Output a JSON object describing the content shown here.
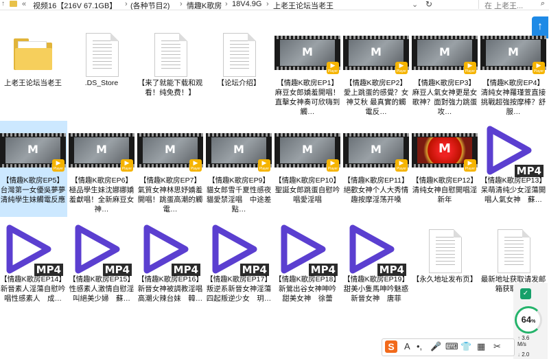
{
  "address_bar": {
    "crumbs": [
      "视频16【216V 67.1GB】",
      "(各种节目2)",
      "情趣K歌房",
      "18V4.9G",
      "上老王论坛当老王"
    ],
    "search_placeholder": "在 上老王..."
  },
  "files": [
    {
      "type": "folder",
      "name": "上老王论坛当老王"
    },
    {
      "type": "doc",
      "name": ".DS_Store"
    },
    {
      "type": "doc",
      "name": "【来了就能下载和观看！纯免费！】"
    },
    {
      "type": "doc",
      "name": "【论坛介绍】"
    },
    {
      "type": "video",
      "name": "【情趣K歌房EP1】麻豆女郎嬌羞開唱！直擊女神奏可欣嗨到觸…"
    },
    {
      "type": "video",
      "name": "【情趣K歌房EP2】愛上跳蛋的感覺？女神艾秋 最真實的觸電反…"
    },
    {
      "type": "video",
      "name": "【情趣K歌房EP3】麻豆人氣女神更是女歌神？面對強力跳蛋攻…"
    },
    {
      "type": "video",
      "name": "【情趣K歌房EP4】清純女神羅瑾萱直接挑戰超強按摩棒？舒服…"
    },
    {
      "type": "video",
      "name": "【情趣K歌房EP5】台灣第一女優吳夢夢　清純學生妹觸電反應",
      "selected": true
    },
    {
      "type": "video",
      "name": "【情趣K歌房EP6】極品學生妹沈娜娜嬌羞獻唱！全新麻豆女神…"
    },
    {
      "type": "video",
      "name": "【情趣K歌房EP7】氣質女神林思妤嬌羞開唱！跳蛋高潮的觸電…"
    },
    {
      "type": "video",
      "name": "【情趣K歌房EP9】貓女郎雪千夏性感夜貓愛禁淫唱　中途差點…"
    },
    {
      "type": "video",
      "name": "【情趣K歌房EP10】聖誕女郎跳蛋自慰吟唱愛淫唱"
    },
    {
      "type": "video",
      "name": "【情趣K歌房EP11】絕歡女神个人大秀情趣按摩淫荡开嗓"
    },
    {
      "type": "video",
      "name": "【情趣K歌房EP12】清纯女神自慰開唱淫新年",
      "variant": "red"
    },
    {
      "type": "mp4",
      "name": "【情趣K歌房EP13】呆萌清纯少女淫蕩開唱人氣女神　蘇…"
    },
    {
      "type": "mp4",
      "name": "【情趣K歌房EP14】新晉素人淫蕩自慰吟唱性感素人　成…"
    },
    {
      "type": "mp4",
      "name": "【情趣K歌房EP15】性感素人激情自慰淫叫絕美少婦　蘇…"
    },
    {
      "type": "mp4",
      "name": "【情趣K歌房EP16】新晉女神被調教淫唱高潮火辣台妹　韓…"
    },
    {
      "type": "mp4",
      "name": "【情趣K歌房EP17】叛逆系新晉女神淫蕩四起叛逆少女　玥…"
    },
    {
      "type": "mp4",
      "name": "【情趣K歌房EP18】新鶯出谷女神呻吟　甜美女神　徐蕾"
    },
    {
      "type": "mp4",
      "name": "【情趣K歌房EP19】甜美小隻馬呻吟魅惑　新晉女神　唐菲"
    },
    {
      "type": "doc",
      "name": "【永久地址发布页】"
    },
    {
      "type": "doc",
      "name": "最新地址获取请发邮箱获取！！"
    }
  ],
  "speed_widget": {
    "percent": "64",
    "unit": "%",
    "up": "3.6",
    "up_unit": "M/s",
    "down": "2.0"
  },
  "ime_toolbar": {
    "logo": "S",
    "items": [
      "A",
      "•,",
      "🎤",
      "⌨",
      "👕",
      "▦",
      "✂"
    ]
  },
  "icons": {
    "player_badge": "Player",
    "mp4_badge": "MP4",
    "film_letter": "M",
    "up_arrow": "↑",
    "shield": "✓",
    "search": "⌕",
    "refresh": "↻"
  },
  "colors": {
    "selection": "#cce8ff",
    "mp4_play": "#5b3fd0",
    "accent_blue": "#1e8ae6"
  }
}
